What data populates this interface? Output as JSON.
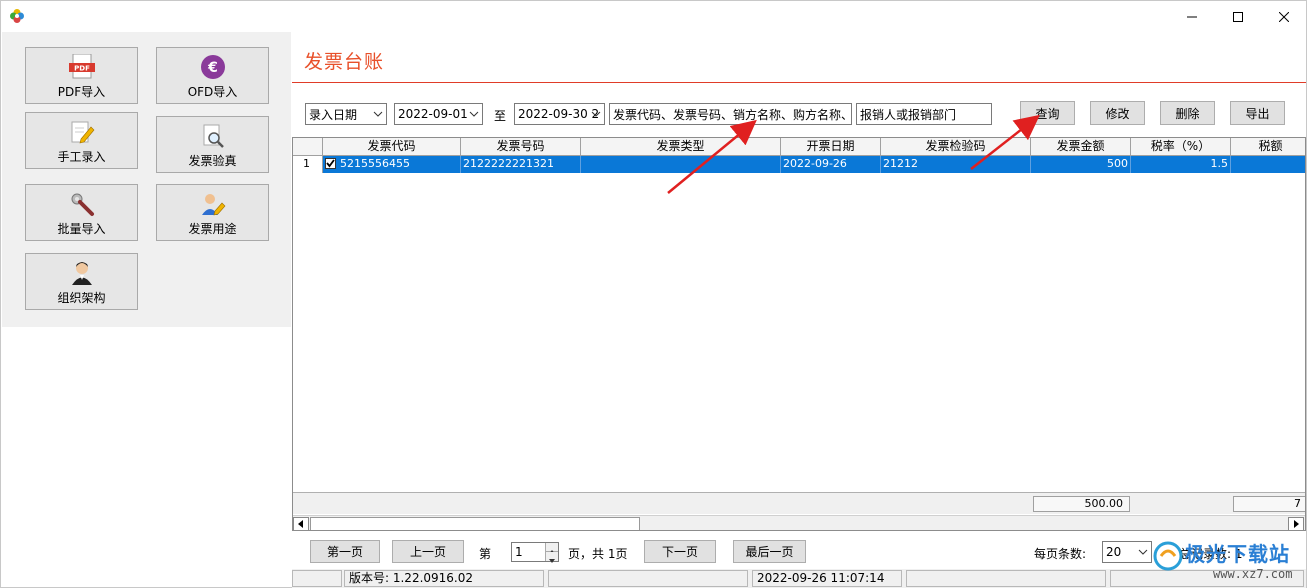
{
  "left_panel": {
    "tiles": [
      {
        "label": "PDF导入",
        "icon": "pdf-file-icon",
        "badge": "PDF"
      },
      {
        "label": "OFD导入",
        "icon": "euro-coin-icon",
        "badge": "€"
      },
      {
        "label": "手工录入",
        "icon": "edit-document-icon"
      },
      {
        "label": "发票验真",
        "icon": "magnify-document-icon"
      },
      {
        "label": "批量导入",
        "icon": "wrench-icon"
      },
      {
        "label": "发票用途",
        "icon": "user-edit-icon"
      },
      {
        "label": "组织架构",
        "icon": "person-avatar-icon"
      }
    ]
  },
  "main": {
    "title": "发票台账",
    "filters": {
      "date_type": "录入日期",
      "date_from": "2022-09-01",
      "to_label": "至",
      "date_to": "2022-09-30 2",
      "keyword_placeholder": "发票代码、发票号码、销方名称、购方名称、",
      "dept_placeholder": "报销人或报销部门"
    },
    "buttons": {
      "query": "查询",
      "edit": "修改",
      "delete": "删除",
      "export": "导出"
    },
    "table": {
      "columns": [
        "",
        "发票代码",
        "发票号码",
        "发票类型",
        "开票日期",
        "发票检验码",
        "发票金额",
        "税率（%）",
        "税额"
      ],
      "rows": [
        {
          "index": "1",
          "checked": true,
          "code": "5215556455",
          "number": "2122222221321",
          "type": "",
          "date": "2022-09-26",
          "check_code": "21212",
          "amount": "500",
          "tax_rate": "1.5",
          "tax": ""
        }
      ],
      "sum_amount": "500.00",
      "sum_tax": "7"
    },
    "pager": {
      "first": "第一页",
      "prev": "上一页",
      "page_prefix": "第",
      "page_value": "1",
      "page_suffix": "页，共 1页",
      "next": "下一页",
      "last": "最后一页",
      "per_page_label": "每页条数:",
      "per_page_value": "20",
      "total_label": "总记录数: 1"
    },
    "status": {
      "version": "版本号: 1.22.0916.02",
      "datetime": "2022-09-26 11:07:14"
    }
  },
  "watermark": {
    "text": "极光下载站",
    "url": "www.xz7.com"
  },
  "colors": {
    "accent": "#e8502a",
    "selection": "#0a78d7",
    "arrow": "#e02020"
  }
}
